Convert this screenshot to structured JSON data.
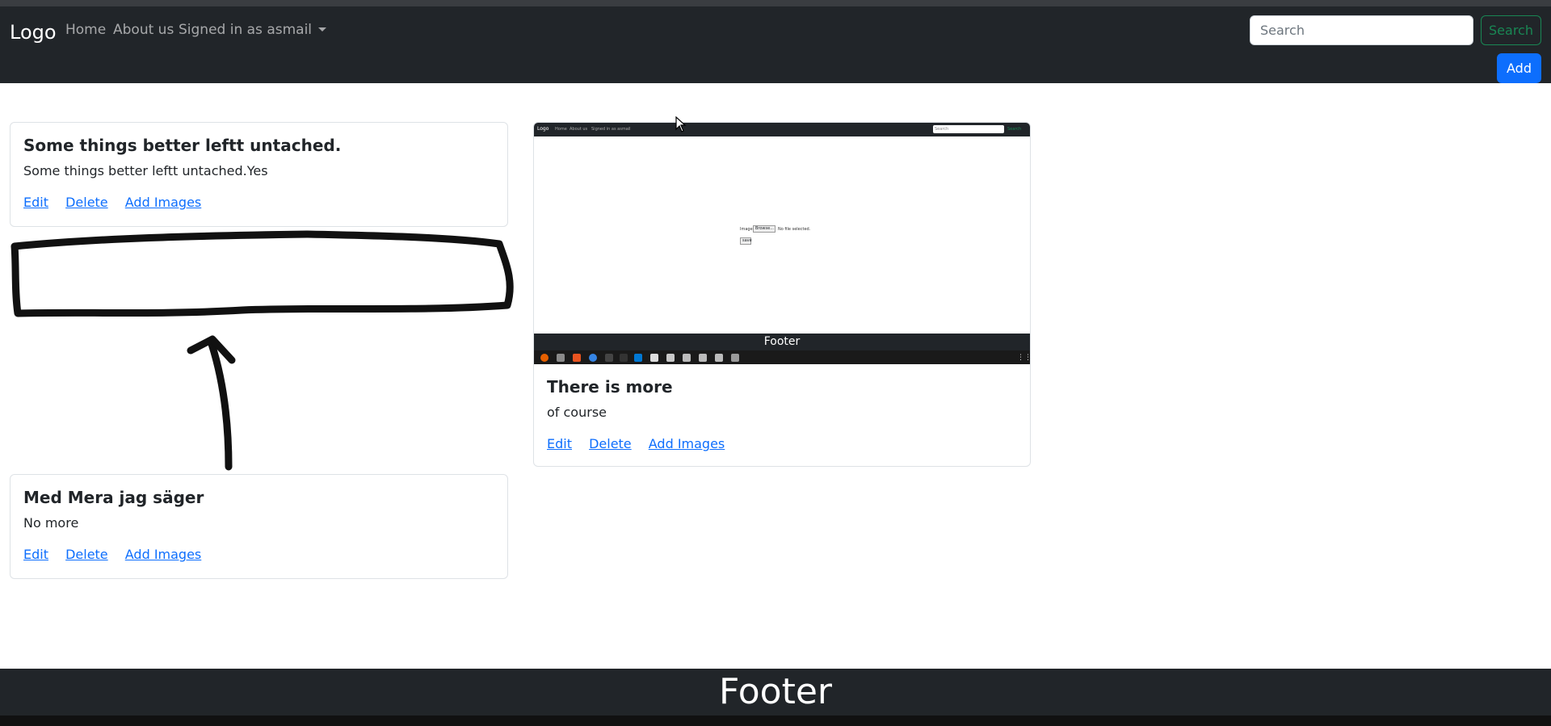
{
  "navbar": {
    "brand": "Logo",
    "links": [
      "Home",
      "About us",
      "Signed in as asmail"
    ],
    "search_placeholder": "Search",
    "search_button": "Search",
    "add_button": "Add"
  },
  "cards": [
    {
      "title": "Some things better leftt untached.",
      "text": "Some things better leftt untached.Yes",
      "links": [
        "Edit",
        "Delete",
        "Add Images"
      ]
    },
    {
      "title": "Med Mera jag säger",
      "text": "No more",
      "links": [
        "Edit",
        "Delete",
        "Add Images"
      ]
    },
    {
      "title": "There is more",
      "text": "of course",
      "links": [
        "Edit",
        "Delete",
        "Add Images"
      ]
    }
  ],
  "card_image": {
    "brand": "Logo",
    "links": [
      "Home",
      "About us",
      "Signed in as asmail"
    ],
    "search_placeholder": "Search",
    "search_button": "Search",
    "image_label": "Image:",
    "browse_button": "Browse...",
    "no_file": "No file selected.",
    "save_button": "save",
    "footer": "Footer"
  },
  "footer": {
    "text": "Footer"
  },
  "colors": {
    "navbar_bg": "#212529",
    "link_blue": "#0d6efd",
    "search_green": "#198754",
    "add_blue": "#0d6efd"
  }
}
